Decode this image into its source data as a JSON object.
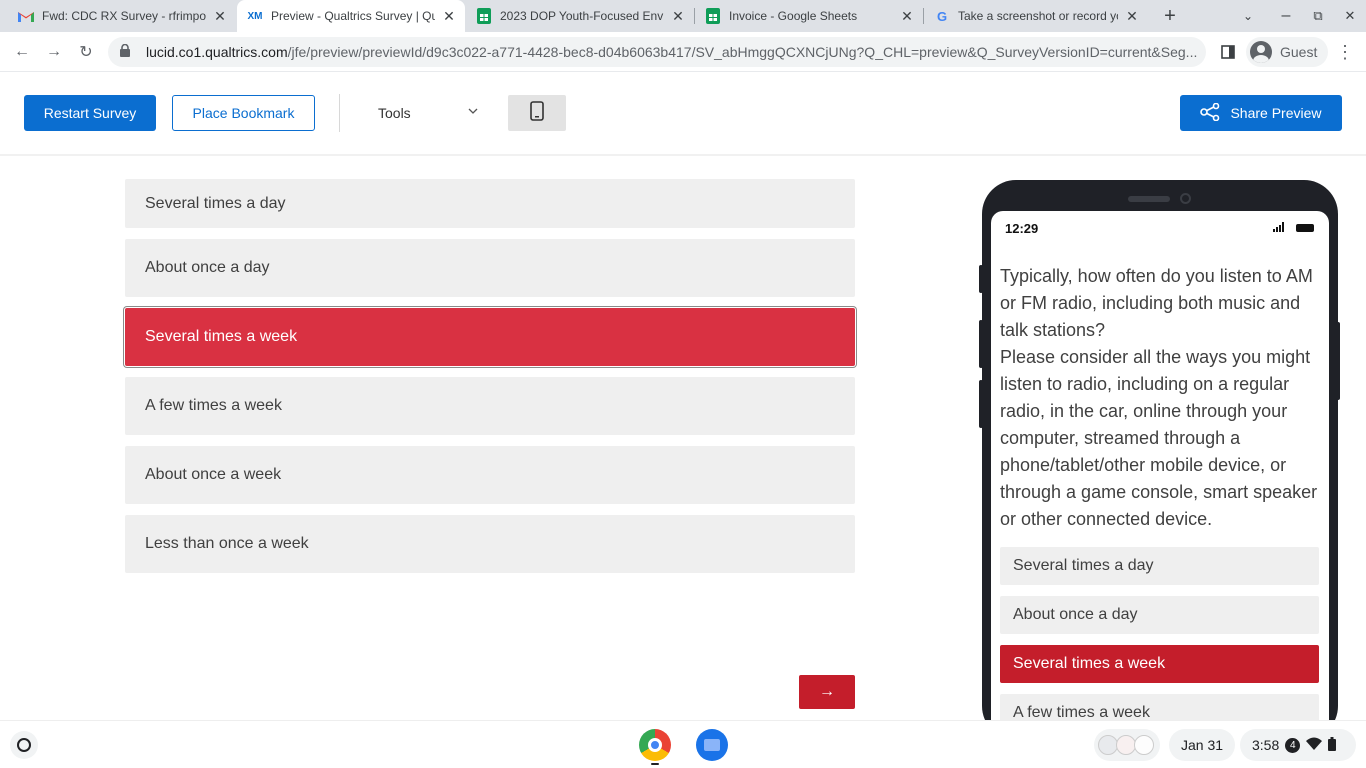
{
  "browser": {
    "tabs": [
      {
        "title": "Fwd: CDC RX Survey - rfrimpong",
        "icon": "gmail-icon",
        "active": false
      },
      {
        "title": "Preview - Qualtrics Survey | Qualtrics",
        "icon": "qualtrics-icon",
        "active": true
      },
      {
        "title": "2023 DOP Youth-Focused Env",
        "icon": "sheets-icon",
        "active": false
      },
      {
        "title": "Invoice - Google Sheets",
        "icon": "sheets-icon",
        "active": false
      },
      {
        "title": "Take a screenshot or record your screen",
        "icon": "google-icon",
        "active": false
      }
    ],
    "url_host": "lucid.co1.qualtrics.com",
    "url_path": "/jfe/preview/previewId/d9c3c022-a771-4428-bec8-d04b6063b417/SV_abHmggQCXNCjUNg?Q_CHL=preview&Q_SurveyVersionID=current&Seg...",
    "profile_label": "Guest"
  },
  "preview_header": {
    "restart_label": "Restart Survey",
    "bookmark_label": "Place Bookmark",
    "tools_label": "Tools",
    "share_label": "Share Preview"
  },
  "survey": {
    "choices": [
      {
        "label": "Several times a day",
        "selected": false
      },
      {
        "label": "About once a day",
        "selected": false
      },
      {
        "label": "Several times a week",
        "selected": true
      },
      {
        "label": "A few times a week",
        "selected": false
      },
      {
        "label": "About once a week",
        "selected": false
      },
      {
        "label": "Less than once a week",
        "selected": false
      }
    ],
    "next_label": "→"
  },
  "mobile_preview": {
    "time": "12:29",
    "question": "Typically, how often do you listen to AM or FM radio, including both music and talk stations?",
    "instructions": "Please consider all the ways you might listen to radio, including on a regular radio, in the car, online through your computer, streamed through a phone/tablet/other mobile device, or through a game console, smart speaker or other connected device.",
    "choices": [
      {
        "label": "Several times a day",
        "selected": false
      },
      {
        "label": "About once a day",
        "selected": false
      },
      {
        "label": "Several times a week",
        "selected": true
      },
      {
        "label": "A few times a week",
        "selected": false
      }
    ]
  },
  "shelf": {
    "date": "Jan 31",
    "time": "3:58",
    "notification_count": "4"
  },
  "colors": {
    "qualtrics_blue": "#0b6ed0",
    "selected_red": "#d93142",
    "next_red": "#c41e2b",
    "choice_gray": "#efefef"
  }
}
